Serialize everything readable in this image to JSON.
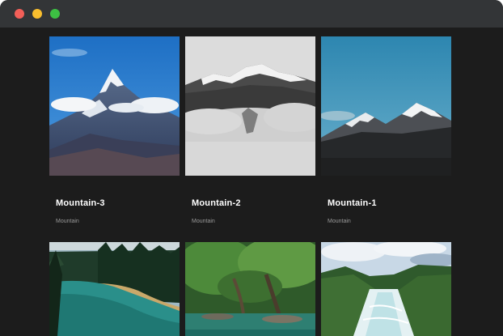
{
  "window": {
    "controls": [
      "close",
      "minimize",
      "maximize"
    ]
  },
  "gallery": {
    "row1": [
      {
        "title": "Mountain-3",
        "category": "Mountain"
      },
      {
        "title": "Mountain-2",
        "category": "Mountain"
      },
      {
        "title": "Mountain-1",
        "category": "Mountain"
      }
    ],
    "row2": [
      {
        "title": "",
        "category": ""
      },
      {
        "title": "",
        "category": ""
      },
      {
        "title": "",
        "category": ""
      }
    ]
  },
  "colors": {
    "background": "#1c1c1c",
    "titlebar": "#333537",
    "close": "#f25f58",
    "minimize": "#f9be2e",
    "maximize": "#3dc143"
  }
}
